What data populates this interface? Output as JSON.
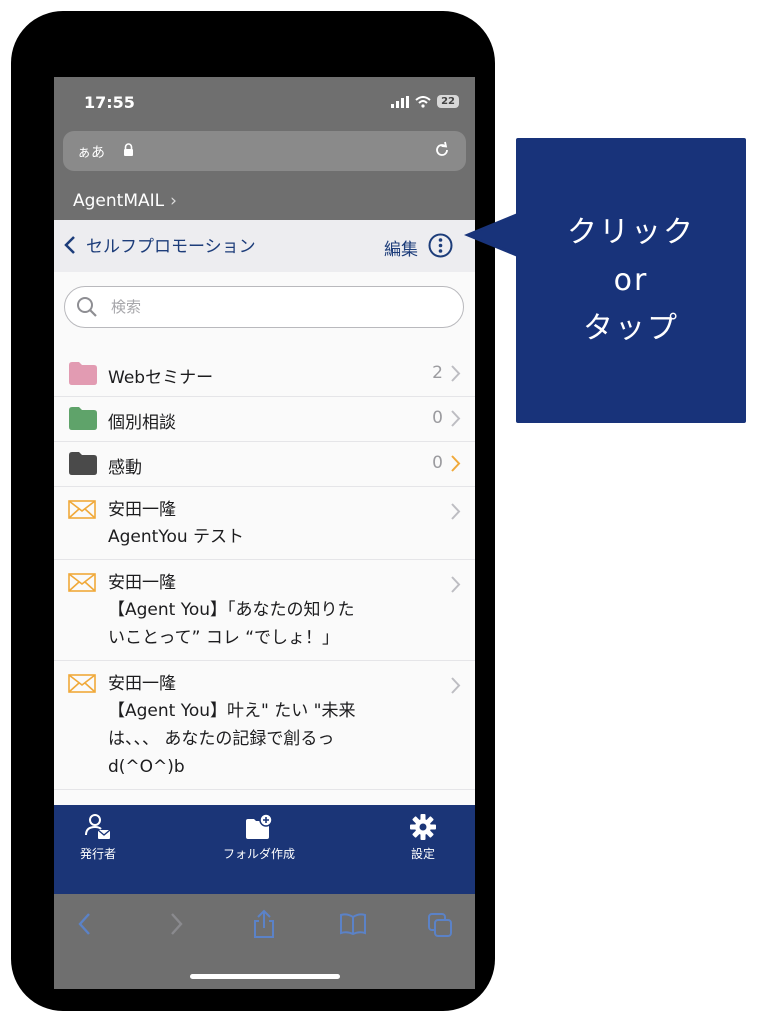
{
  "status_bar": {
    "time": "17:55",
    "battery": "22"
  },
  "browser": {
    "text_size_label": "ぁあ",
    "breadcrumb": "AgentMAIL",
    "toolbar_icons": [
      "back-icon",
      "forward-icon",
      "share-icon",
      "bookmarks-icon",
      "tabs-icon"
    ]
  },
  "header": {
    "back_label": "セルフプロモーション",
    "edit_label": "編集",
    "more_icon": "ellipsis-circle-icon"
  },
  "search": {
    "placeholder": "検索",
    "value": ""
  },
  "folders": [
    {
      "label": "Webセミナー",
      "count": "2",
      "color": "#e29bb2"
    },
    {
      "label": "個別相談",
      "count": "0",
      "color": "#5fa36a"
    },
    {
      "label": "感動",
      "count": "0",
      "color": "#4a4a4a",
      "chevron_color": "#f0a93a"
    }
  ],
  "messages": [
    {
      "sender": "安田一隆",
      "subject": "AgentYou テスト"
    },
    {
      "sender": "安田一隆",
      "subject": "【Agent You】「あなたの知りた\nいことって” コレ “でしょ！」"
    },
    {
      "sender": "安田一隆",
      "subject": "【Agent You】叶え\" たい \"未来\nは、、、 あなたの記録で創るっ\nd(^O^)b"
    }
  ],
  "tabs": [
    {
      "label": "発行者",
      "icon": "publisher-icon"
    },
    {
      "label": "フォルダ作成",
      "icon": "folder-add-icon"
    },
    {
      "label": "設定",
      "icon": "gear-icon"
    }
  ],
  "callout": {
    "line1": "クリック",
    "line2": "or",
    "line3": "タップ"
  },
  "colors": {
    "accent": "#1b3577",
    "link": "#1d3d7a",
    "mail_icon": "#f0a93a"
  }
}
